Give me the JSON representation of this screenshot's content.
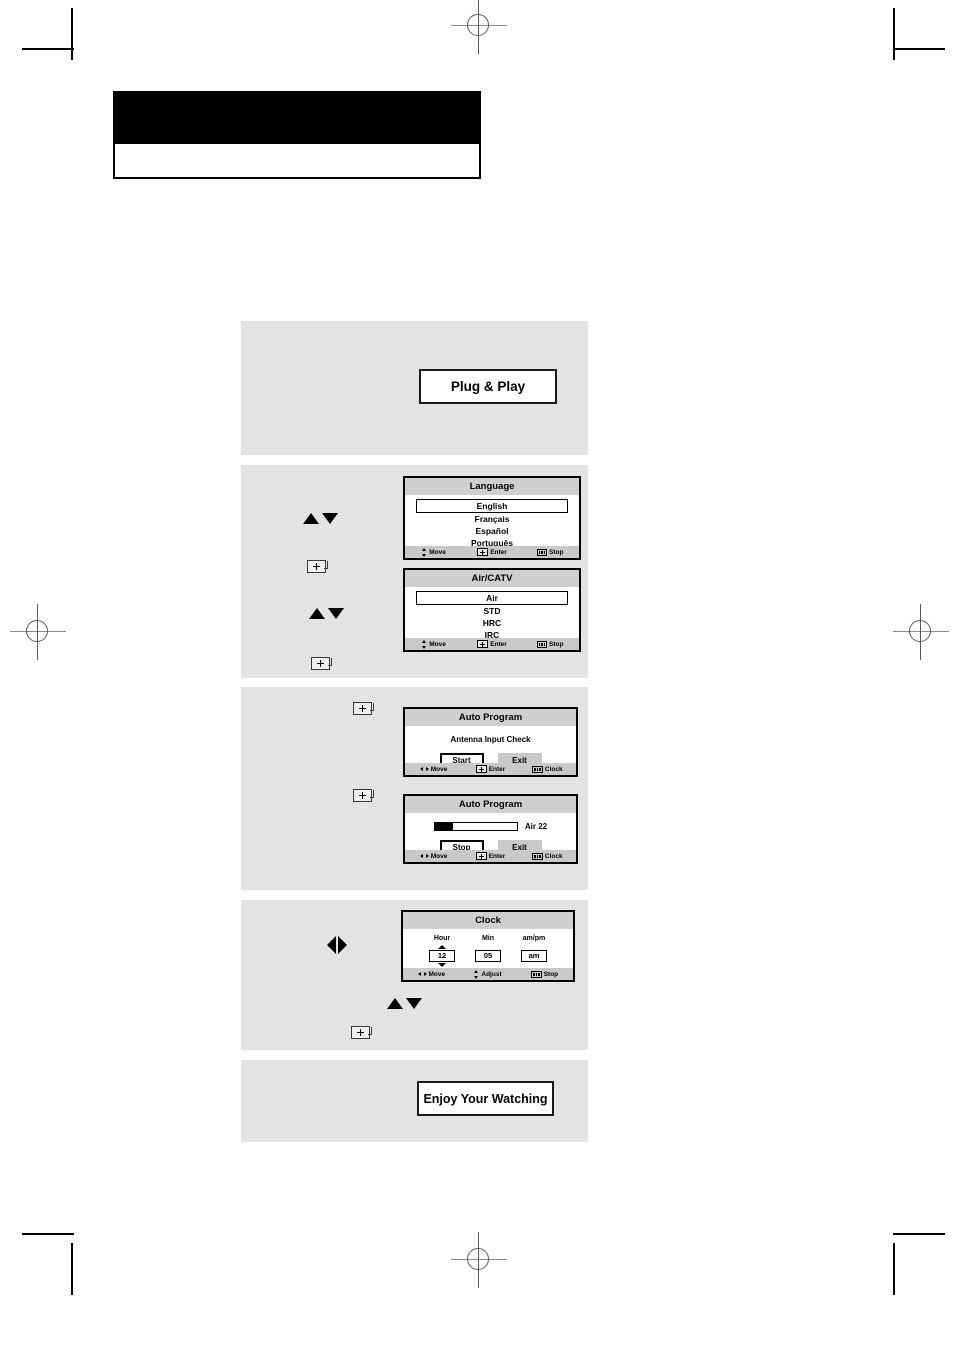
{
  "page": {
    "header": {
      "title": "",
      "subtitle": ""
    },
    "background": "#ffffff",
    "section_bg": "#e3e3e3"
  },
  "flow": {
    "start_box": {
      "label": "Plug & Play"
    },
    "end_box": {
      "label": "Enjoy Your Watching"
    },
    "step_icons": {
      "up_down": "up-down-arrows-icon",
      "left_right": "left-right-arrows-icon",
      "enter": "enter-key-icon"
    }
  },
  "screens": {
    "language": {
      "title": "Language",
      "items": [
        {
          "label": "English",
          "selected": true
        },
        {
          "label": "Français",
          "selected": false
        },
        {
          "label": "Español",
          "selected": false
        },
        {
          "label": "Português",
          "selected": false
        }
      ],
      "footer": [
        {
          "icon": "up-down-arrows-icon",
          "label": "Move"
        },
        {
          "icon": "enter-key-icon",
          "label": "Enter"
        },
        {
          "icon": "menu-bars-icon",
          "label": "Stop"
        }
      ]
    },
    "air_catv": {
      "title": "Air/CATV",
      "items": [
        {
          "label": "Air",
          "selected": true
        },
        {
          "label": "STD",
          "selected": false
        },
        {
          "label": "HRC",
          "selected": false
        },
        {
          "label": "IRC",
          "selected": false
        }
      ],
      "footer": [
        {
          "icon": "up-down-arrows-icon",
          "label": "Move"
        },
        {
          "icon": "enter-key-icon",
          "label": "Enter"
        },
        {
          "icon": "menu-bars-icon",
          "label": "Stop"
        }
      ]
    },
    "auto_program_check": {
      "title": "Auto Program",
      "message": "Antenna Input Check",
      "buttons": [
        {
          "label": "Start",
          "selected": true
        },
        {
          "label": "Exit",
          "selected": false
        }
      ],
      "footer": [
        {
          "icon": "left-right-arrows-icon",
          "label": "Move"
        },
        {
          "icon": "enter-key-icon",
          "label": "Enter"
        },
        {
          "icon": "menu-bars-icon",
          "label": "Clock"
        }
      ]
    },
    "auto_program_scan": {
      "title": "Auto Program",
      "progress_percent": 22,
      "channel": "Air 22",
      "buttons": [
        {
          "label": "Stop",
          "selected": true
        },
        {
          "label": "Exit",
          "selected": false
        }
      ],
      "footer": [
        {
          "icon": "left-right-arrows-icon",
          "label": "Move"
        },
        {
          "icon": "enter-key-icon",
          "label": "Enter"
        },
        {
          "icon": "menu-bars-icon",
          "label": "Clock"
        }
      ]
    },
    "clock": {
      "title": "Clock",
      "field_labels": {
        "hour": "Hour",
        "min": "Min",
        "ampm": "am/pm"
      },
      "field_values": {
        "hour": "12",
        "min": "05",
        "ampm": "am"
      },
      "footer": [
        {
          "icon": "left-right-arrows-icon",
          "label": "Move"
        },
        {
          "icon": "up-down-arrows-icon",
          "label": "Adjust"
        },
        {
          "icon": "menu-bars-icon",
          "label": "Stop"
        }
      ]
    }
  }
}
